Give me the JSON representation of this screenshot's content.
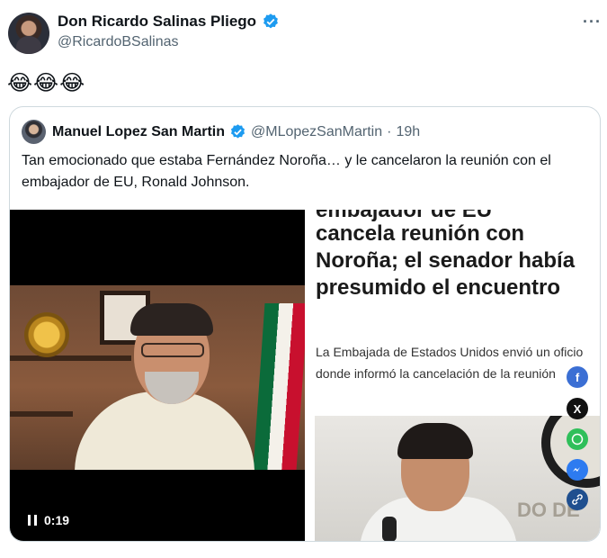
{
  "post": {
    "author_name": "Don Ricardo Salinas Pliego",
    "author_handle": "@RicardoBSalinas",
    "more_label": "···",
    "text": "😂😂😂"
  },
  "quote": {
    "author_name": "Manuel Lopez San Martin",
    "author_handle": "@MLopezSanMartin",
    "separator": "·",
    "time": "19h",
    "text": "Tan emocionado que estaba Fernández Noroña… y le cancelaron la reunión con el embajador de EU, Ronald Johnson."
  },
  "video": {
    "time": "0:19"
  },
  "article": {
    "headline_cut": "embajador de EU",
    "headline": "cancela reunión con Noroña; el senador había presumido el encuentro",
    "summary": "La Embajada de Estados Unidos envió un oficio donde informó la cancelación de la reunión",
    "seal_text": "DO DE"
  },
  "share_icons": [
    "facebook-icon",
    "x-icon",
    "whatsapp-icon",
    "messenger-icon",
    "link-icon"
  ],
  "colors": {
    "verified": "#1d9bf0",
    "muted": "#536471",
    "border": "#cfd9de"
  }
}
